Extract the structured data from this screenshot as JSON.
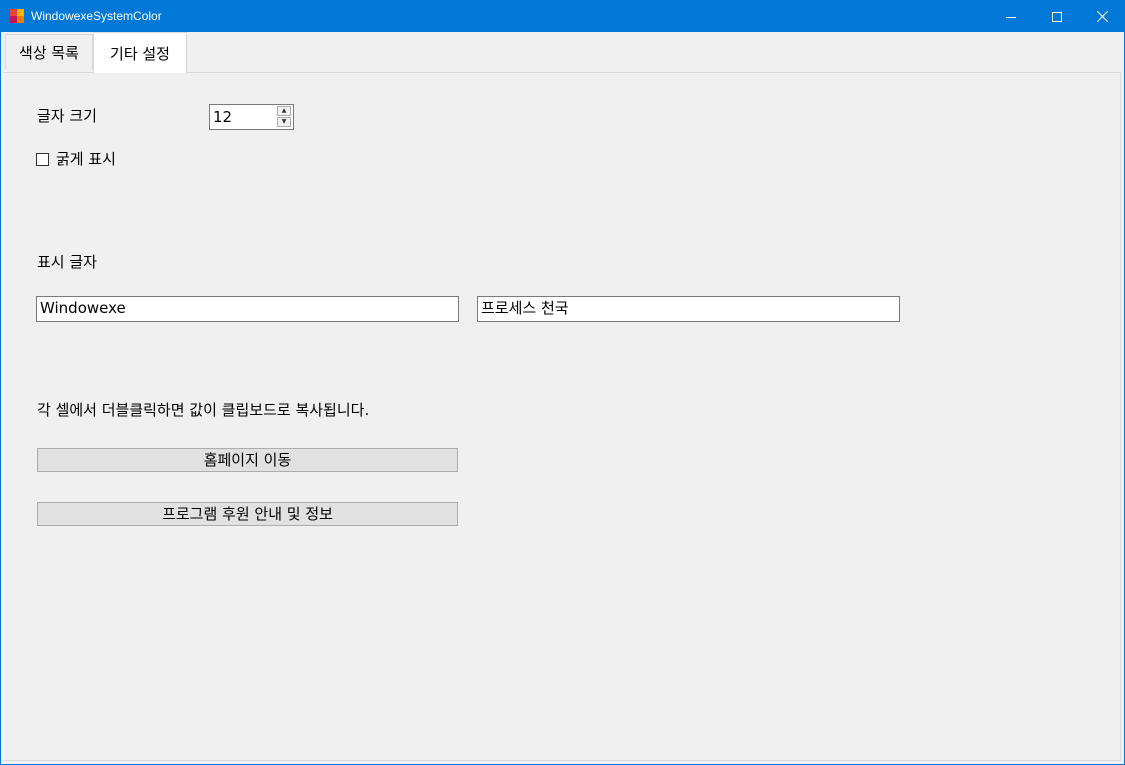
{
  "window": {
    "title": "WindowexeSystemColor",
    "accent_color": "#0078d7",
    "controls": {
      "minimize_icon": "minimize-icon",
      "maximize_icon": "maximize-icon",
      "close_icon": "close-icon"
    }
  },
  "tabs": [
    {
      "label": "색상 목록",
      "active": false
    },
    {
      "label": "기타 설정",
      "active": true
    }
  ],
  "settings": {
    "font_size_label": "글자 크기",
    "font_size_value": "12",
    "bold_label": "굵게 표시",
    "bold_checked": false,
    "display_text_label": "표시 글자",
    "display_text_1": "Windowexe",
    "display_text_2": "프로세스 천국",
    "hint_text": "각 셀에서 더블클릭하면 값이 클립보드로 복사됩니다.",
    "homepage_button": "홈페이지 이동",
    "sponsor_button": "프로그램 후원 안내 및 정보"
  }
}
